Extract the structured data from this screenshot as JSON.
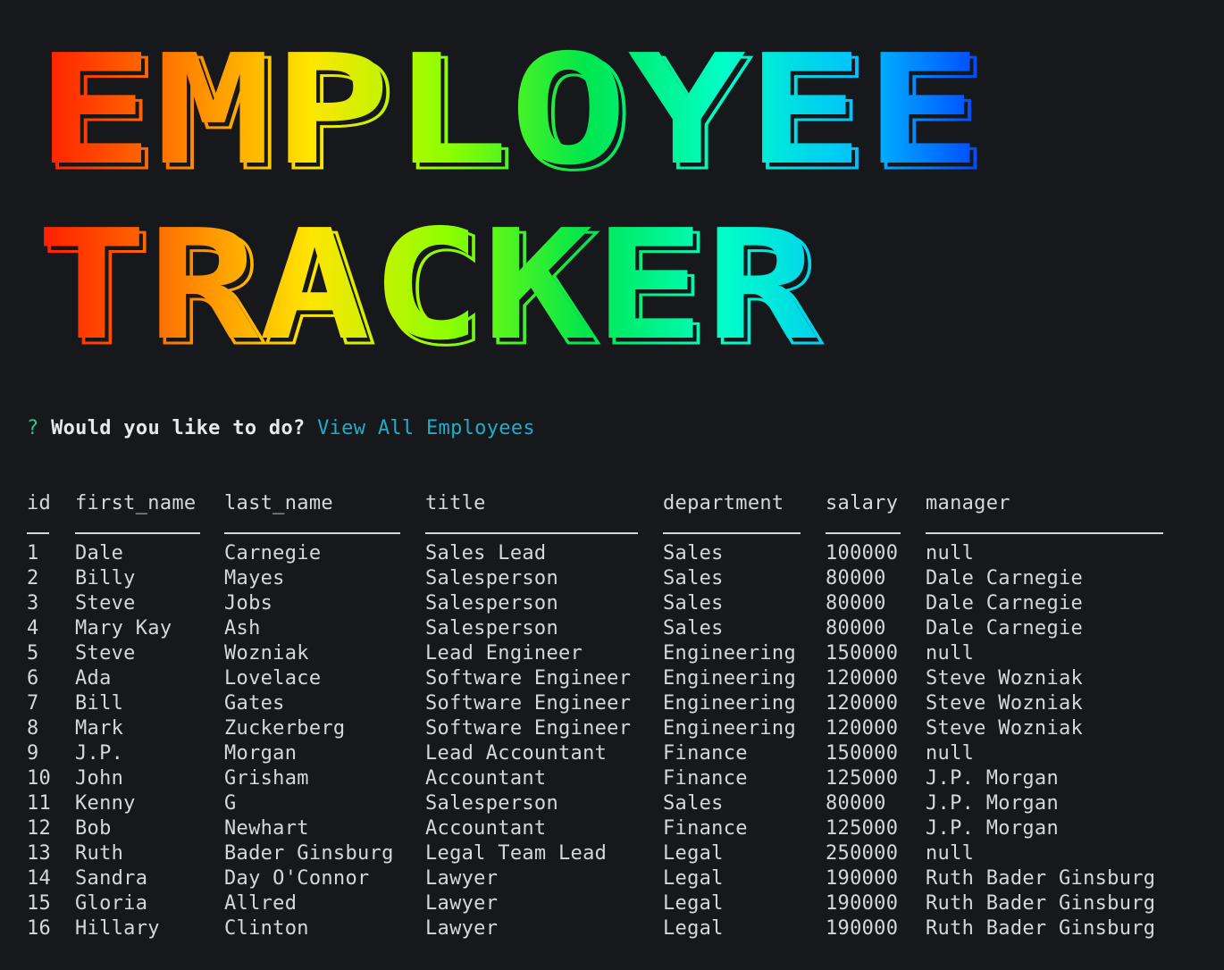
{
  "banner": {
    "line1": "EMPLOYEE",
    "line2": "TRACKER"
  },
  "prompt": {
    "mark": "?",
    "question": "Would you like to do?",
    "answer": "View All Employees"
  },
  "table": {
    "headers": [
      "id",
      "first_name",
      "last_name",
      "title",
      "department",
      "salary",
      "manager"
    ],
    "rows": [
      [
        "1",
        "Dale",
        "Carnegie",
        "Sales Lead",
        "Sales",
        "100000",
        "null"
      ],
      [
        "2",
        "Billy",
        "Mayes",
        "Salesperson",
        "Sales",
        "80000",
        "Dale Carnegie"
      ],
      [
        "3",
        "Steve",
        "Jobs",
        "Salesperson",
        "Sales",
        "80000",
        "Dale Carnegie"
      ],
      [
        "4",
        "Mary Kay",
        "Ash",
        "Salesperson",
        "Sales",
        "80000",
        "Dale Carnegie"
      ],
      [
        "5",
        "Steve",
        "Wozniak",
        "Lead Engineer",
        "Engineering",
        "150000",
        "null"
      ],
      [
        "6",
        "Ada",
        "Lovelace",
        "Software Engineer",
        "Engineering",
        "120000",
        "Steve Wozniak"
      ],
      [
        "7",
        "Bill",
        "Gates",
        "Software Engineer",
        "Engineering",
        "120000",
        "Steve Wozniak"
      ],
      [
        "8",
        "Mark",
        "Zuckerberg",
        "Software Engineer",
        "Engineering",
        "120000",
        "Steve Wozniak"
      ],
      [
        "9",
        "J.P.",
        "Morgan",
        "Lead Accountant",
        "Finance",
        "150000",
        "null"
      ],
      [
        "10",
        "John",
        "Grisham",
        "Accountant",
        "Finance",
        "125000",
        "J.P. Morgan"
      ],
      [
        "11",
        "Kenny",
        "G",
        "Salesperson",
        "Sales",
        "80000",
        "J.P. Morgan"
      ],
      [
        "12",
        "Bob",
        "Newhart",
        "Accountant",
        "Finance",
        "125000",
        "J.P. Morgan"
      ],
      [
        "13",
        "Ruth",
        "Bader Ginsburg",
        "Legal Team Lead",
        "Legal",
        "250000",
        "null"
      ],
      [
        "14",
        "Sandra",
        "Day O'Connor",
        "Lawyer",
        "Legal",
        "190000",
        "Ruth Bader Ginsburg"
      ],
      [
        "15",
        "Gloria",
        "Allred",
        "Lawyer",
        "Legal",
        "190000",
        "Ruth Bader Ginsburg"
      ],
      [
        "16",
        "Hillary",
        "Clinton",
        "Lawyer",
        "Legal",
        "190000",
        "Ruth Bader Ginsburg"
      ]
    ]
  },
  "colors": {
    "background": "#17181c",
    "text": "#d6d7db",
    "prompt_mark": "#32c18f",
    "answer": "#1eaec9",
    "gradient": [
      "#ff1a00",
      "#ff8a00",
      "#ffe600",
      "#8cff00",
      "#00e64d",
      "#00ffc8",
      "#00bfff",
      "#0033ff"
    ]
  }
}
